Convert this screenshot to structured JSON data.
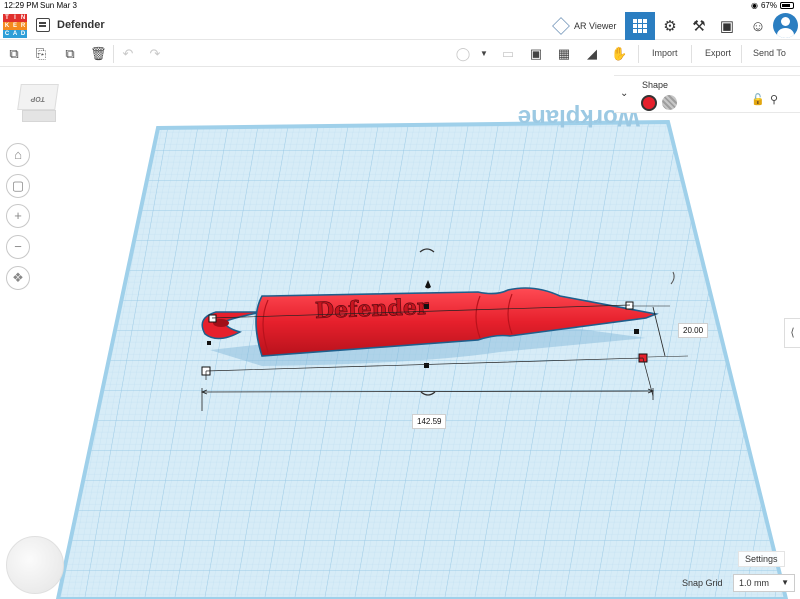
{
  "status_bar": {
    "time": "12:29 PM",
    "date": "Sun Mar 3",
    "battery": "67%"
  },
  "app": {
    "logo_letters": [
      "T",
      "I",
      "N",
      "K",
      "E",
      "R",
      "C",
      "A",
      "D"
    ],
    "logo_colors": [
      "#e1302d",
      "#e1302d",
      "#e1302d",
      "#f48a1e",
      "#f48a1e",
      "#f48a1e",
      "#2e9fd8",
      "#2e9fd8",
      "#2e9fd8"
    ],
    "project_title": "Defender",
    "ar_viewer_label": "AR Viewer"
  },
  "toolbar": {
    "import_label": "Import",
    "export_label": "Export",
    "send_to_label": "Send To"
  },
  "viewcube": {
    "face_label": "TOP"
  },
  "workplane": {
    "label": "Workplane",
    "grid_color": "#cfe6f3",
    "line_color": "#8fc3e3"
  },
  "model": {
    "text": "Defender",
    "color": "#e6202c",
    "width_value": "142.59",
    "height_value": "20.00"
  },
  "shape_panel": {
    "title": "Shape",
    "solid_color": "#e6202c"
  },
  "bottom": {
    "settings_label": "Settings",
    "snap_grid_label": "Snap Grid",
    "snap_grid_value": "1.0 mm"
  }
}
